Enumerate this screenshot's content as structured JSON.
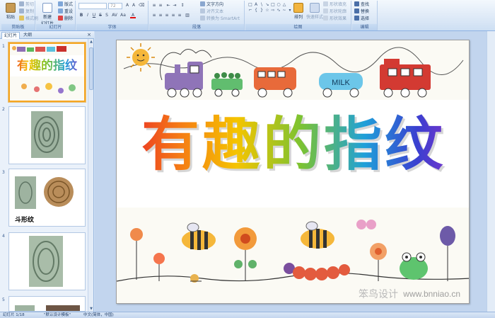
{
  "ribbon": {
    "clipboard": {
      "label": "剪贴板",
      "paste": "粘贴",
      "cut": "剪切",
      "copy": "复制",
      "format_painter": "格式刷"
    },
    "slides": {
      "label": "幻灯片",
      "new_slide": "新建",
      "new_slide_line2": "幻灯片",
      "layout": "版式",
      "reset": "重设",
      "delete": "删除"
    },
    "font": {
      "label": "字体",
      "font_size": "72"
    },
    "paragraph": {
      "label": "段落",
      "text_direction": "文字方向",
      "align_text": "对齐文本",
      "smartart": "转换为 SmartArt"
    },
    "drawing": {
      "label": "绘图",
      "arrange": "排列",
      "quick_styles": "快速样式",
      "shape_fill": "形状填充",
      "shape_outline": "形状轮廓",
      "shape_effects": "形状效果"
    },
    "editing": {
      "label": "编辑",
      "find": "查找",
      "replace": "替换",
      "select": "选择"
    }
  },
  "panel": {
    "tabs": [
      "幻灯片",
      "大纲"
    ],
    "close": "×",
    "slides": [
      {
        "num": "1",
        "title": "有趣的指纹"
      },
      {
        "num": "2"
      },
      {
        "num": "3",
        "caption": "斗形纹"
      },
      {
        "num": "4"
      },
      {
        "num": "5"
      }
    ]
  },
  "slide": {
    "title": "有趣的指纹",
    "milk": "MILK",
    "watermark": "www.bnniao.cn",
    "watermark_logo": "笨鸟设计"
  },
  "status": {
    "slide_info": "幻灯片 1/18",
    "theme": "\"默认设计模板\"",
    "language": "中文(简体，中国)"
  }
}
